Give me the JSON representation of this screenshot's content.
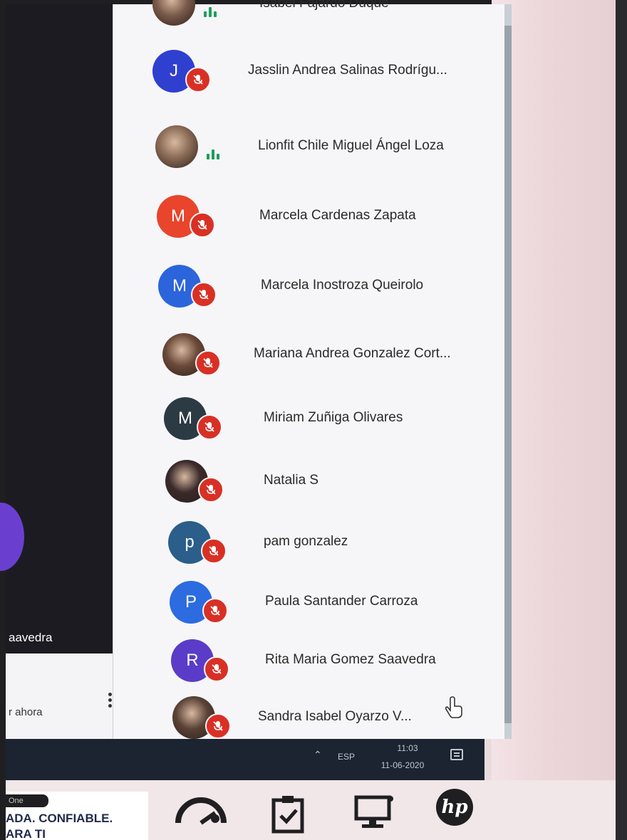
{
  "participants": [
    {
      "name": "Isabel Fajardo Duque",
      "initial": "",
      "avatar_color": "#7a5a4a",
      "photo": true,
      "state": "speaking"
    },
    {
      "name": "Jasslin Andrea Salinas Rodrígu...",
      "initial": "J",
      "avatar_color": "#2f3fd0",
      "photo": false,
      "state": "muted"
    },
    {
      "name": "Lionfit Chile Miguel Ángel Loza",
      "initial": "",
      "avatar_color": "#8a6a55",
      "photo": true,
      "state": "speaking"
    },
    {
      "name": "Marcela Cardenas Zapata",
      "initial": "M",
      "avatar_color": "#e8452c",
      "photo": false,
      "state": "muted"
    },
    {
      "name": "Marcela Inostroza Queirolo",
      "initial": "M",
      "avatar_color": "#2c64dc",
      "photo": false,
      "state": "muted"
    },
    {
      "name": "Mariana Andrea Gonzalez Cort...",
      "initial": "",
      "avatar_color": "#6b4a3a",
      "photo": true,
      "state": "muted"
    },
    {
      "name": "Miriam Zuñiga Olivares",
      "initial": "M",
      "avatar_color": "#2c3a44",
      "photo": false,
      "state": "muted"
    },
    {
      "name": "Natalia S",
      "initial": "",
      "avatar_color": "#3a2a2a",
      "photo": true,
      "state": "muted"
    },
    {
      "name": "pam gonzalez",
      "initial": "p",
      "avatar_color": "#2b5e8a",
      "photo": false,
      "state": "muted"
    },
    {
      "name": "Paula Santander Carroza",
      "initial": "P",
      "avatar_color": "#2c6be0",
      "photo": false,
      "state": "muted"
    },
    {
      "name": "Rita Maria Gomez Saavedra",
      "initial": "R",
      "avatar_color": "#5a3cc8",
      "photo": false,
      "state": "muted"
    },
    {
      "name": "Sandra Isabel Oyarzo V...",
      "initial": "",
      "avatar_color": "#5a4236",
      "photo": true,
      "state": "muted"
    }
  ],
  "video": {
    "name": "aavedra"
  },
  "caption": {
    "text": "r ahora"
  },
  "taskbar": {
    "lang": "ESP",
    "time": "11:03",
    "date": "11-06-2020"
  },
  "sticker": {
    "tag": "One",
    "line1": "ADA. CONFIABLE.",
    "line2": "ARA TI"
  },
  "hp": {
    "logo": "hp"
  },
  "colors": {
    "mute": "#d93025",
    "speaking": "#1e9e5a",
    "panel": "#f6f6f8"
  }
}
